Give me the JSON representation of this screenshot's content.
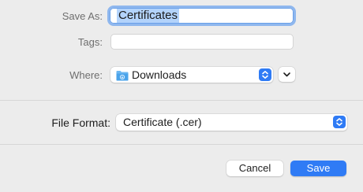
{
  "save_as": {
    "label": "Save As:",
    "value": "Certificates"
  },
  "tags": {
    "label": "Tags:",
    "value": ""
  },
  "where": {
    "label": "Where:",
    "selected": "Downloads",
    "icon": "folder-icon"
  },
  "file_format": {
    "label": "File Format:",
    "selected": "Certificate (.cer)"
  },
  "buttons": {
    "cancel": "Cancel",
    "save": "Save"
  },
  "colors": {
    "accent": "#2f7bf5",
    "selection": "#b3d3fb",
    "focus_ring": "#8fb7ee",
    "background": "#ececec"
  }
}
